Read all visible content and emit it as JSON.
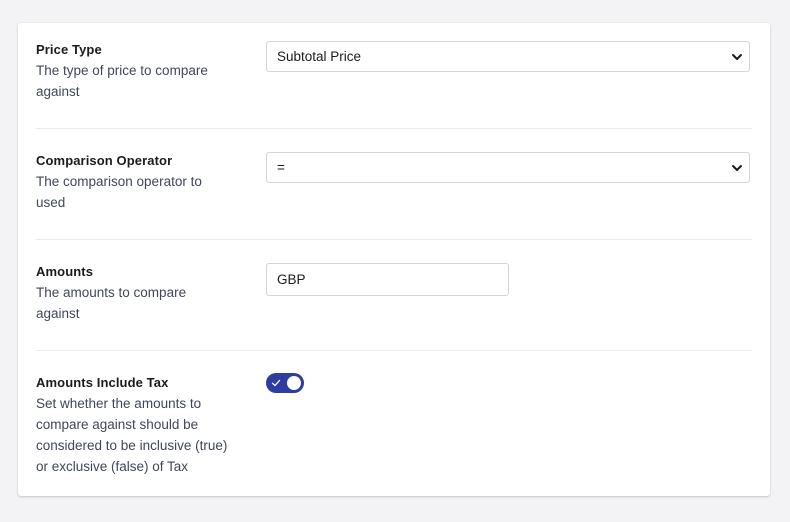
{
  "fields": [
    {
      "label": "Price Type",
      "description_lines": [
        "The type of price to compare",
        "against"
      ],
      "control": "select",
      "value": "Subtotal Price"
    },
    {
      "label": "Comparison Operator",
      "description_lines": [
        "The comparison operator to",
        "used"
      ],
      "control": "select",
      "value": "="
    },
    {
      "label": "Amounts",
      "description_lines": [
        "The amounts to compare",
        "against"
      ],
      "control": "input",
      "value": "GBP"
    },
    {
      "label": "Amounts Include Tax",
      "description_lines": [
        "Set whether the amounts to",
        "compare against should be",
        "considered to be inclusive (true)",
        "or exclusive (false) of Tax"
      ],
      "control": "toggle",
      "checked": true
    }
  ],
  "icons": {
    "select_arrow": "chevron-down-icon",
    "toggle_on": "checkmark-icon"
  },
  "colors": {
    "toggle_on": "#2f3da0",
    "page_background": "#f3f3f5",
    "label_text": "#1b1b1b",
    "description_text": "#40465a"
  }
}
